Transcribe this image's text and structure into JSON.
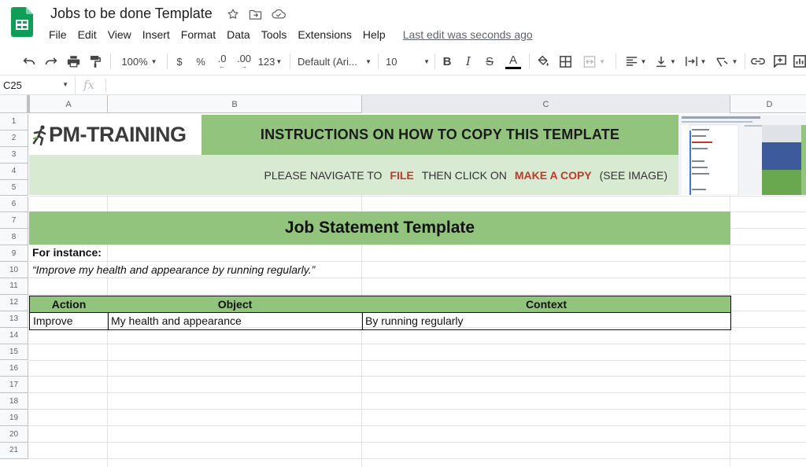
{
  "app": {
    "doc_title": "Jobs to be done Template",
    "menus": [
      "File",
      "Edit",
      "View",
      "Insert",
      "Format",
      "Data",
      "Tools",
      "Extensions",
      "Help"
    ],
    "last_edit": "Last edit was seconds ago"
  },
  "toolbar": {
    "zoom": "100%",
    "currency": "$",
    "percent": "%",
    "decrease_decimal": ".0",
    "increase_decimal": ".00",
    "more_formats": "123",
    "font": "Default (Ari...",
    "font_size": "10",
    "bold": "B",
    "italic": "I",
    "strike": "S",
    "text_color": "A"
  },
  "formula_bar": {
    "cell_ref": "C25",
    "fx": "fx",
    "value": ""
  },
  "grid": {
    "columns": [
      "A",
      "B",
      "C",
      "D"
    ],
    "rows": [
      "1",
      "2",
      "3",
      "4",
      "5",
      "6",
      "7",
      "8",
      "9",
      "10",
      "11",
      "12",
      "13",
      "14",
      "15",
      "16",
      "17",
      "18",
      "19",
      "20",
      "21"
    ]
  },
  "sheet": {
    "logo_text_pm": "PM",
    "logo_text_rest": "-TRAINING",
    "instructions_title": "INSTRUCTIONS ON HOW TO COPY THIS TEMPLATE",
    "instructions": {
      "part1": "PLEASE NAVIGATE TO",
      "file": "FILE",
      "part2": "THEN CLICK ON",
      "make_copy": "MAKE A COPY",
      "part3": "(SEE IMAGE)"
    },
    "job_title": "Job Statement Template",
    "for_instance": "For instance:",
    "example": "“Improve my health and appearance by running regularly.”",
    "table": {
      "headers": [
        "Action",
        "Object",
        "Context"
      ],
      "row": [
        "Improve",
        "My health and appearance",
        "By running regularly"
      ]
    }
  },
  "colors": {
    "header_green": "#93c47d",
    "light_green": "#d9ead3",
    "accent_red": "#c0392b",
    "sheets_green": "#0f9d58"
  }
}
